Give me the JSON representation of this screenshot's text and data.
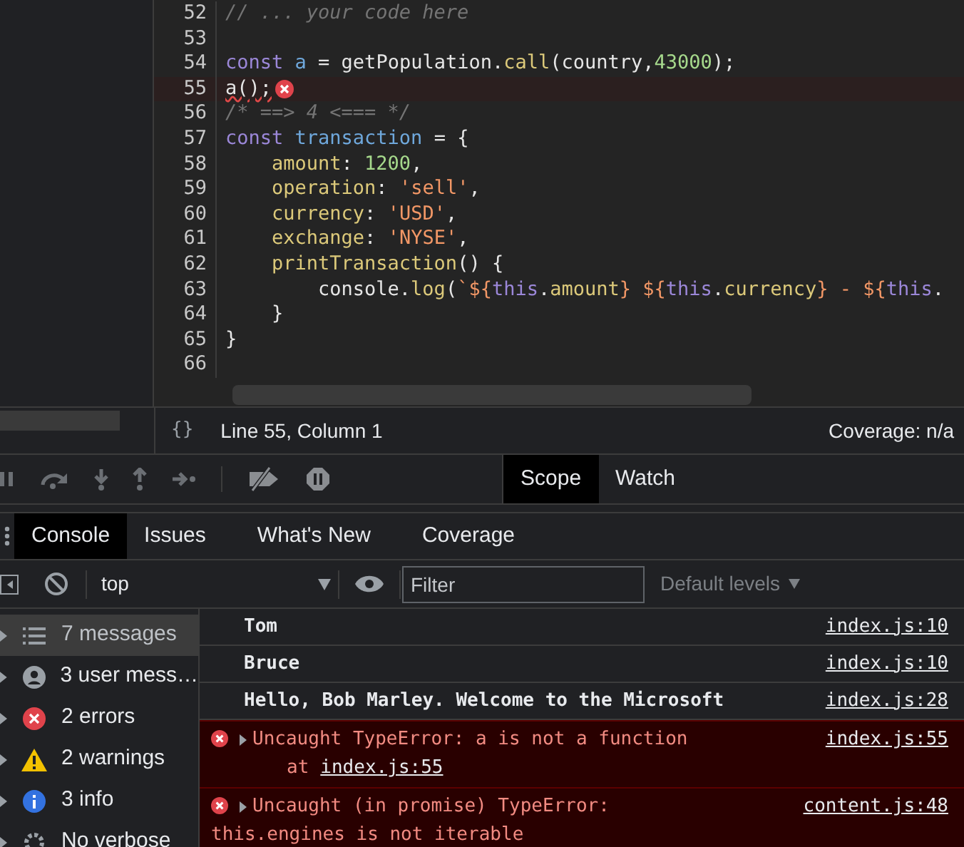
{
  "editor": {
    "lines": [
      {
        "number": "52",
        "tokens": [
          {
            "kind": "comment",
            "text": "// ... your code here"
          }
        ]
      },
      {
        "number": "53"
      },
      {
        "number": "54",
        "tokens": [
          {
            "kind": "keyword",
            "text": "const "
          },
          {
            "kind": "variable",
            "text": "a"
          },
          {
            "kind": "plain",
            "text": " = getPopulation."
          },
          {
            "kind": "method",
            "text": "call"
          },
          {
            "kind": "plain",
            "text": "(country,"
          },
          {
            "kind": "number",
            "text": "43000"
          },
          {
            "kind": "plain",
            "text": ");"
          }
        ]
      },
      {
        "number": "55",
        "error": true,
        "tokens": [
          {
            "kind": "plain",
            "text": "a();"
          }
        ]
      },
      {
        "number": "56",
        "tokens": [
          {
            "kind": "comment",
            "text": "/* ==> 4 <=== */"
          }
        ]
      },
      {
        "number": "57",
        "tokens": [
          {
            "kind": "keyword",
            "text": "const "
          },
          {
            "kind": "variable",
            "text": "transaction"
          },
          {
            "kind": "plain",
            "text": " = {"
          }
        ]
      },
      {
        "number": "58",
        "tokens": [
          {
            "kind": "property",
            "text": "    amount"
          },
          {
            "kind": "plain",
            "text": ": "
          },
          {
            "kind": "number",
            "text": "1200"
          },
          {
            "kind": "plain",
            "text": ","
          }
        ]
      },
      {
        "number": "59",
        "tokens": [
          {
            "kind": "property",
            "text": "    operation"
          },
          {
            "kind": "plain",
            "text": ": "
          },
          {
            "kind": "string",
            "text": "'sell'"
          },
          {
            "kind": "plain",
            "text": ","
          }
        ]
      },
      {
        "number": "60",
        "tokens": [
          {
            "kind": "property",
            "text": "    currency"
          },
          {
            "kind": "plain",
            "text": ": "
          },
          {
            "kind": "string",
            "text": "'USD'"
          },
          {
            "kind": "plain",
            "text": ","
          }
        ]
      },
      {
        "number": "61",
        "tokens": [
          {
            "kind": "property",
            "text": "    exchange"
          },
          {
            "kind": "plain",
            "text": ": "
          },
          {
            "kind": "string",
            "text": "'NYSE'"
          },
          {
            "kind": "plain",
            "text": ","
          }
        ]
      },
      {
        "number": "62",
        "tokens": [
          {
            "kind": "property",
            "text": "    printTransaction"
          },
          {
            "kind": "plain",
            "text": "() {"
          }
        ]
      },
      {
        "number": "63",
        "tokens": [
          {
            "kind": "plain",
            "text": "        console."
          },
          {
            "kind": "method",
            "text": "log"
          },
          {
            "kind": "plain",
            "text": "("
          },
          {
            "kind": "string",
            "text": "`${"
          },
          {
            "kind": "keyword",
            "text": "this"
          },
          {
            "kind": "plain",
            "text": "."
          },
          {
            "kind": "method",
            "text": "amount"
          },
          {
            "kind": "string",
            "text": "} ${"
          },
          {
            "kind": "keyword",
            "text": "this"
          },
          {
            "kind": "plain",
            "text": "."
          },
          {
            "kind": "method",
            "text": "currency"
          },
          {
            "kind": "string",
            "text": "} - ${"
          },
          {
            "kind": "keyword",
            "text": "this"
          },
          {
            "kind": "plain",
            "text": "."
          }
        ]
      },
      {
        "number": "64",
        "tokens": [
          {
            "kind": "plain",
            "text": "    }"
          }
        ]
      },
      {
        "number": "65",
        "tokens": [
          {
            "kind": "plain",
            "text": "}"
          }
        ]
      },
      {
        "number": "66"
      }
    ]
  },
  "status_bar": {
    "icon": "{}",
    "position": "Line 55, Column 1",
    "coverage": "Coverage: n/a"
  },
  "side_tabs": [
    {
      "label": "Scope",
      "selected": true
    },
    {
      "label": "Watch",
      "selected": false
    }
  ],
  "drawer_tabs": [
    {
      "label": "Console",
      "selected": true
    },
    {
      "label": "Issues",
      "selected": false
    },
    {
      "label": "What's New",
      "selected": false
    },
    {
      "label": "Coverage",
      "selected": false
    }
  ],
  "console_toolbar": {
    "context": "top",
    "filter_placeholder": "Filter",
    "levels": "Default levels"
  },
  "sidebar": [
    {
      "kind": "messages",
      "label": "7 messages",
      "selected": true
    },
    {
      "kind": "user",
      "label": "3 user mess…",
      "selected": false
    },
    {
      "kind": "errors",
      "label": "2 errors",
      "selected": false
    },
    {
      "kind": "warnings",
      "label": "2 warnings",
      "selected": false
    },
    {
      "kind": "info",
      "label": "3 info",
      "selected": false
    },
    {
      "kind": "verbose",
      "label": "No verbose",
      "selected": false
    }
  ],
  "messages": [
    {
      "kind": "log",
      "text": "Tom",
      "source": "index.js:10"
    },
    {
      "kind": "log",
      "text": "Bruce",
      "source": "index.js:10"
    },
    {
      "kind": "log",
      "text": "Hello, Bob Marley. Welcome to the Microsoft",
      "source": "index.js:28"
    },
    {
      "kind": "error",
      "text": "Uncaught TypeError: a is not a function",
      "stack_prefix": "at",
      "stack_link": "index.js:55",
      "source": "index.js:55"
    },
    {
      "kind": "error",
      "text": "Uncaught (in promise) TypeError:",
      "continuation": "this.engines is not iterable",
      "source": "content.js:48"
    }
  ]
}
